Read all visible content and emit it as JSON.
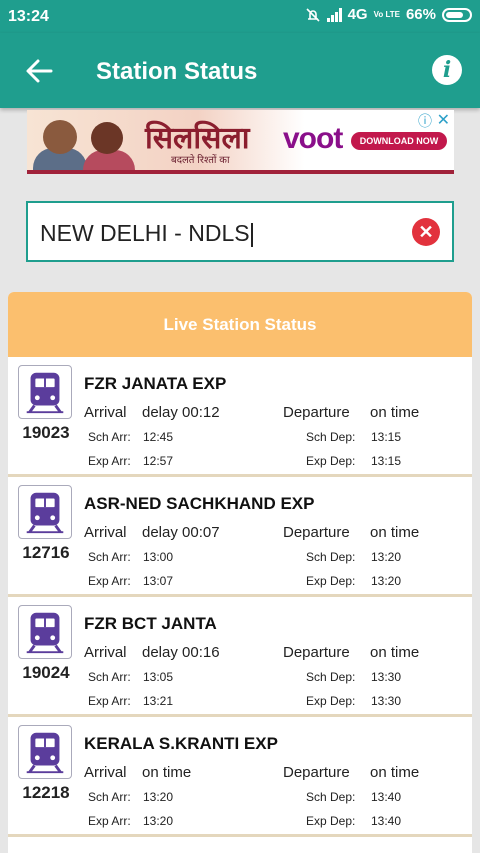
{
  "status_bar": {
    "time": "13:24",
    "network": "4G",
    "volte": "Vo LTE",
    "battery": "66%"
  },
  "app_bar": {
    "title": "Station Status",
    "back_icon": "arrow-left-icon",
    "info_icon": "info-icon"
  },
  "ad": {
    "show_title": "सिलसिला",
    "show_sub": "बदलते रिश्तों का",
    "brand": "voot",
    "cta": "DOWNLOAD NOW",
    "ad_info_icon": "ad-choices-icon",
    "close_icon": "close-icon"
  },
  "search": {
    "value": "NEW DELHI - NDLS",
    "clear_icon": "clear-icon"
  },
  "panel": {
    "header": "Live Station Status"
  },
  "labels": {
    "arrival": "Arrival",
    "departure": "Departure",
    "sch_arr": "Sch Arr:",
    "exp_arr": "Exp Arr:",
    "sch_dep": "Sch Dep:",
    "exp_dep": "Exp Dep:"
  },
  "trains": [
    {
      "number": "19023",
      "name": "FZR JANATA EXP",
      "arrival_status": "delay 00:12",
      "departure_status": "on time",
      "sch_arr": "12:45",
      "exp_arr": "12:57",
      "sch_dep": "13:15",
      "exp_dep": "13:15"
    },
    {
      "number": "12716",
      "name": "ASR-NED SACHKHAND EXP",
      "arrival_status": "delay 00:07",
      "departure_status": "on time",
      "sch_arr": "13:00",
      "exp_arr": "13:07",
      "sch_dep": "13:20",
      "exp_dep": "13:20"
    },
    {
      "number": "19024",
      "name": "FZR BCT JANTA",
      "arrival_status": "delay 00:16",
      "departure_status": "on time",
      "sch_arr": "13:05",
      "exp_arr": "13:21",
      "sch_dep": "13:30",
      "exp_dep": "13:30"
    },
    {
      "number": "12218",
      "name": "KERALA S.KRANTI EXP",
      "arrival_status": "on time",
      "departure_status": "on time",
      "sch_arr": "13:20",
      "exp_arr": "13:20",
      "sch_dep": "13:40",
      "exp_dep": "13:40"
    }
  ],
  "colors": {
    "primary": "#1f9e8e",
    "header_orange": "#fbbf6e",
    "train_icon": "#5b3d9c",
    "clear_red": "#e2323d"
  }
}
